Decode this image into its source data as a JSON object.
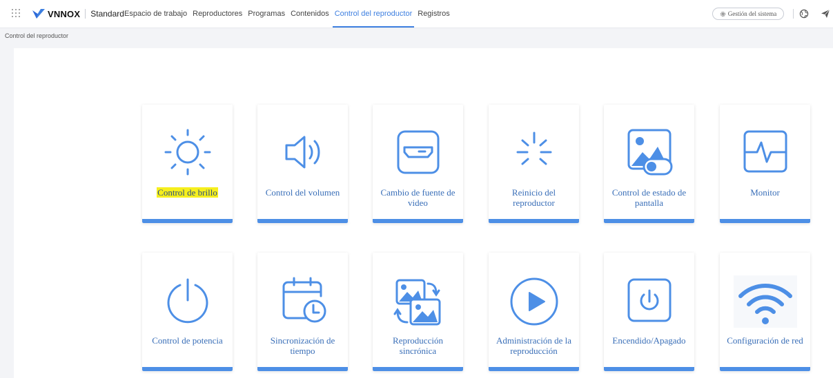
{
  "header": {
    "brand": "VNNOX",
    "edition": "Standard",
    "nav": [
      {
        "label": "Espacio de trabajo"
      },
      {
        "label": "Reproductores"
      },
      {
        "label": "Programas"
      },
      {
        "label": "Contenidos"
      },
      {
        "label": "Control del reproductor",
        "active": true
      },
      {
        "label": "Registros"
      }
    ],
    "system_button": "Gestión del sistema"
  },
  "breadcrumb": "Control del reproductor",
  "cards": [
    {
      "label": "Control de brillo",
      "icon": "brightness-icon",
      "highlighted": true
    },
    {
      "label": "Control del volumen",
      "icon": "volume-icon"
    },
    {
      "label": "Cambio de fuente de video",
      "icon": "video-source-icon"
    },
    {
      "label": "Reinicio del reproductor",
      "icon": "restart-icon"
    },
    {
      "label": "Control de estado de pantalla",
      "icon": "screen-status-icon"
    },
    {
      "label": "Monitor",
      "icon": "monitor-icon"
    },
    {
      "label": "Control de potencia",
      "icon": "power-icon"
    },
    {
      "label": "Sincronización de tiempo",
      "icon": "time-sync-icon"
    },
    {
      "label": "Reproducción sincrónica",
      "icon": "sync-playback-icon"
    },
    {
      "label": "Administración de la reproducción",
      "icon": "play-icon"
    },
    {
      "label": "Encendido/Apagado",
      "icon": "on-off-icon"
    },
    {
      "label": "Configuración de red",
      "icon": "wifi-icon"
    }
  ],
  "colors": {
    "accent": "#3d7fe0",
    "icon": "#4d8fe6",
    "label": "#3a6fb8",
    "highlight": "#f6ef1d"
  }
}
